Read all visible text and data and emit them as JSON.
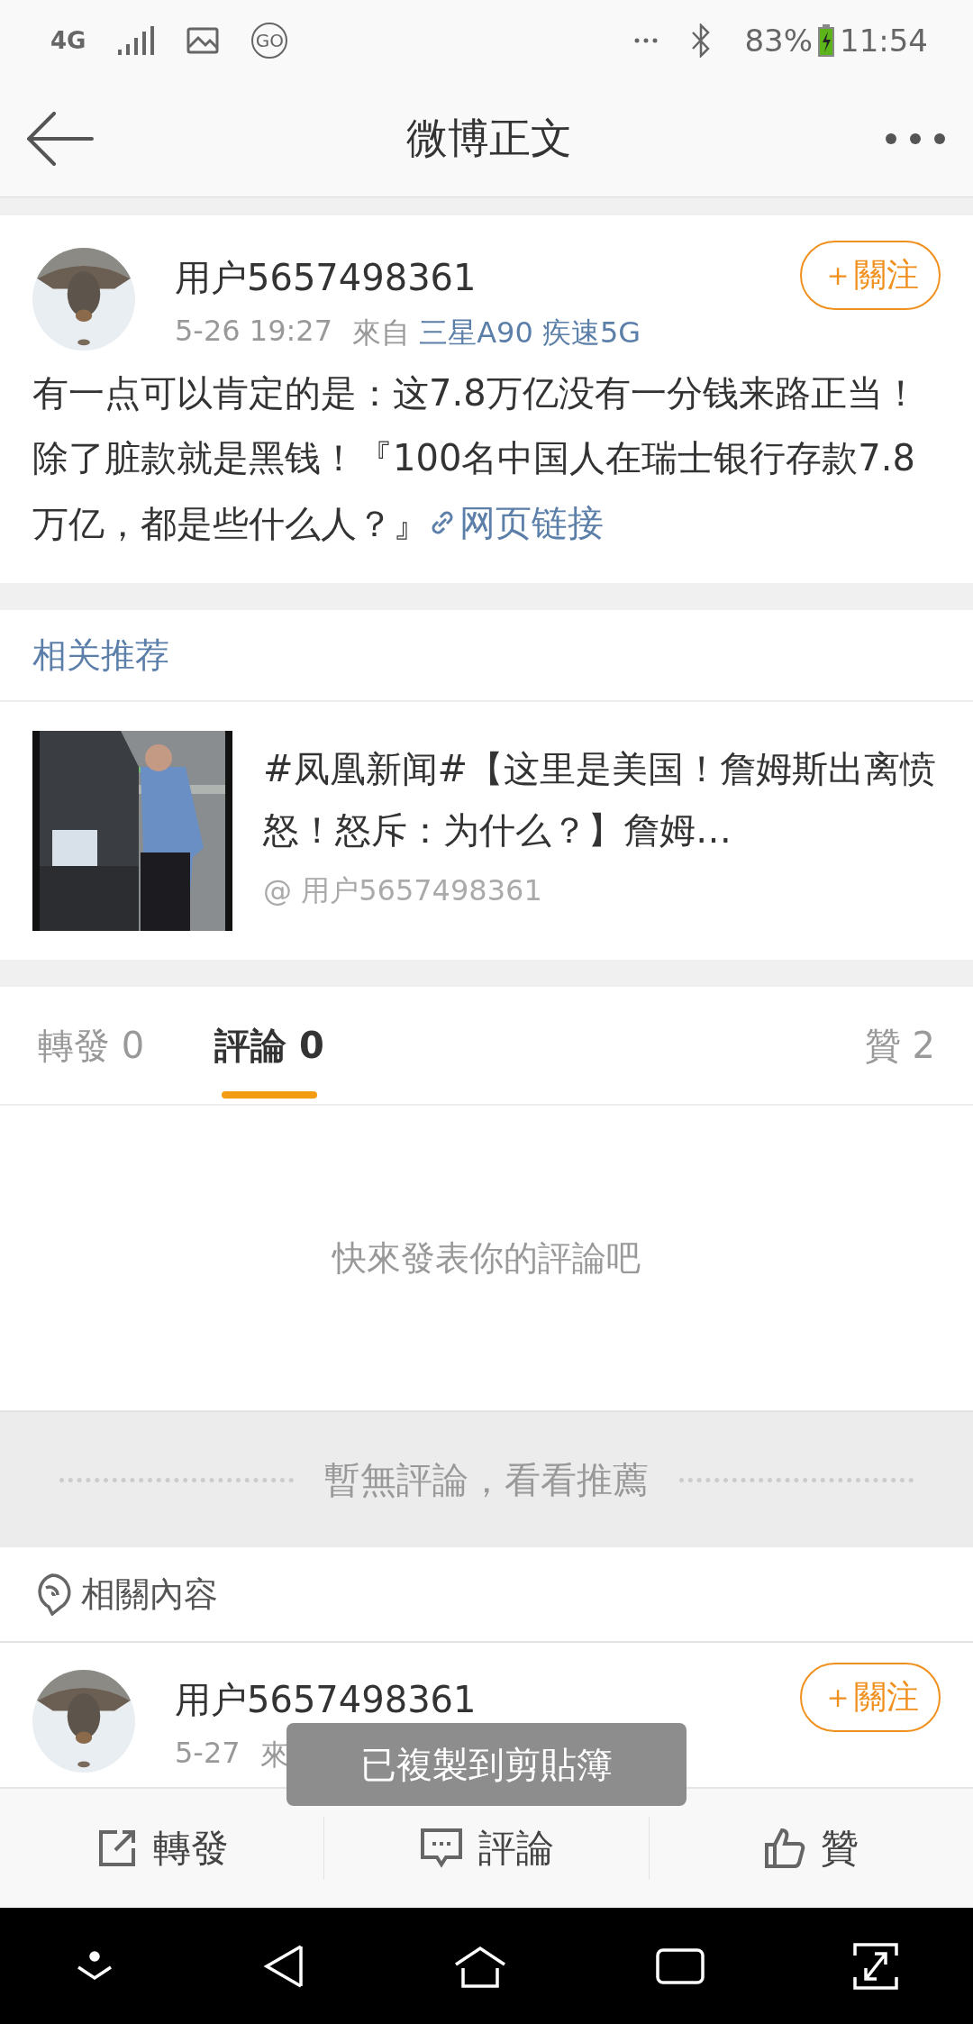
{
  "status_bar": {
    "network": "4G",
    "go": "GO",
    "battery": "83%",
    "time": "11:54"
  },
  "header": {
    "title": "微博正文"
  },
  "post": {
    "user": "用户5657498361",
    "time": "5-26 19:27",
    "source_prefix": "來自",
    "source": "三星A90 疾速5G",
    "follow_label": "＋關注",
    "text": "有一点可以肯定的是：这7.8万亿没有一分钱来路正当！除了脏款就是黑钱！『100名中国人在瑞士银行存款7.8万亿，都是些什么人？』",
    "link": "网页链接"
  },
  "recommend": {
    "heading": "相关推荐",
    "title": "#凤凰新闻#【这里是美国！詹姆斯出离愤怒！怒斥：为什么？】詹姆…",
    "author": "@ 用户5657498361"
  },
  "tabs": [
    {
      "label": "轉發",
      "count": "0",
      "selected": false
    },
    {
      "label": "評論",
      "count": "0",
      "selected": true
    },
    {
      "label": "贊",
      "count": "2",
      "selected": false
    }
  ],
  "empty_text": "快來發表你的評論吧",
  "divider_text": "暫無評論，看看推薦",
  "related": {
    "heading": "相關內容"
  },
  "related_post": {
    "user": "用户5657498361",
    "time": "5-27",
    "source_prefix": "來",
    "follow_label": "＋關注"
  },
  "actions": [
    {
      "label": "轉發",
      "kind": "share"
    },
    {
      "label": "評論",
      "kind": "comment"
    },
    {
      "label": "贊",
      "kind": "like"
    }
  ],
  "toast": "已複製到剪貼簿"
}
